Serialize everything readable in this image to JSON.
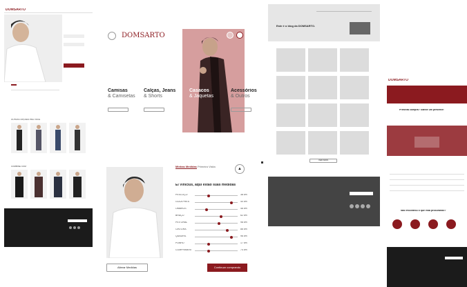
{
  "colors": {
    "brand": "#8b1a1f",
    "dark_footer": "#1b1b1b",
    "gray_footer": "#444444",
    "placeholder": "#dcdcdc"
  },
  "logos": {
    "a": "DOMSARTO",
    "b": "DOMSARTO",
    "c": "DOMSARTO"
  },
  "categories": [
    {
      "title": "Camisas",
      "sub": "& Camisetas"
    },
    {
      "title": "Calças, Jeans",
      "sub": "& Shorts"
    },
    {
      "title": "Casacos",
      "sub": "& Jaquetas"
    },
    {
      "title": "Acessórios",
      "sub": "& Outros"
    }
  ],
  "blog": {
    "title": "Este é o blog da DOMSARTO.",
    "button": "VER MAIS"
  },
  "measure": {
    "tab_active": "Minhas Medidas",
    "tab_inactive": "Primeira Visita",
    "heading": "Ei Vinicius, aqui estão suas medidas",
    "rows": [
      {
        "label": "PESCOÇO",
        "value": "38 cm",
        "pos": 0.3
      },
      {
        "label": "GOLA PRES",
        "value": "40 cm",
        "pos": 0.85
      },
      {
        "label": "OMBROS",
        "value": "46 cm",
        "pos": 0.25
      },
      {
        "label": "BRAÇO",
        "value": "62 cm",
        "pos": 0.6
      },
      {
        "label": "PEITORAL",
        "value": "98 cm",
        "pos": 0.55
      },
      {
        "label": "CINTURA",
        "value": "86 cm",
        "pos": 0.75
      },
      {
        "label": "QUADRIL",
        "value": "96 cm",
        "pos": 0.85
      },
      {
        "label": "PUNHO",
        "value": "17 cm",
        "pos": 0.3
      },
      {
        "label": "COMPRIMENTO",
        "value": "74 cm",
        "pos": 0.3
      }
    ],
    "btn_left": "Alterar Medidas",
    "btn_right": "Continuar comprando"
  },
  "promo": {
    "title": "Primeira compra? Ganhe um presente!"
  },
  "contact": {
    "title": "Não encontrou o que está procurando?"
  },
  "product_grid_a": {
    "label": "OUTRAS OPÇÕES PRA VOCÊ"
  },
  "product_grid_b": {
    "label": "COMBINE COM"
  }
}
